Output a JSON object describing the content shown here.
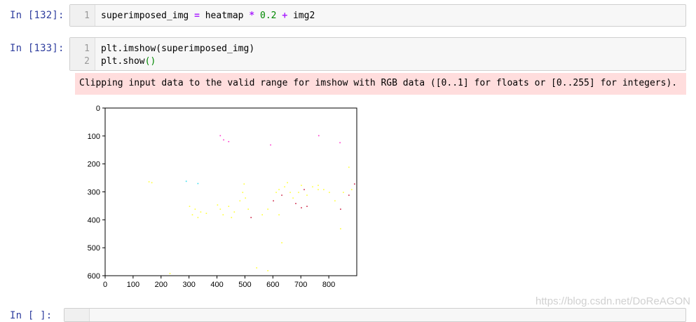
{
  "cells": [
    {
      "prompt": "In  [132]:",
      "lines": [
        {
          "no": "1",
          "text": "superimposed_img = heatmap * 0.2 + img2"
        }
      ]
    },
    {
      "prompt": "In  [133]:",
      "lines": [
        {
          "no": "1",
          "text": "plt.imshow(superimposed_img)"
        },
        {
          "no": "2",
          "text": "plt.show()"
        }
      ]
    }
  ],
  "stderr": "Clipping input data to the valid range for imshow with RGB data ([0..1] for floats or [0..255] for integers).",
  "next_prompt": "In  [ ]:",
  "watermark": "https://blog.csdn.net/DoReAGON",
  "chart_data": {
    "type": "image",
    "xticks": [
      "0",
      "100",
      "200",
      "300",
      "400",
      "500",
      "600",
      "700",
      "800"
    ],
    "yticks": [
      "0",
      "100",
      "200",
      "300",
      "400",
      "500",
      "600"
    ],
    "xlim": [
      0,
      900
    ],
    "ylim": [
      600,
      0
    ],
    "colors": {
      "yellow": "#ffff33",
      "magenta": "#ff33cc",
      "red": "#cc2244",
      "cyan": "#33ddee"
    }
  }
}
